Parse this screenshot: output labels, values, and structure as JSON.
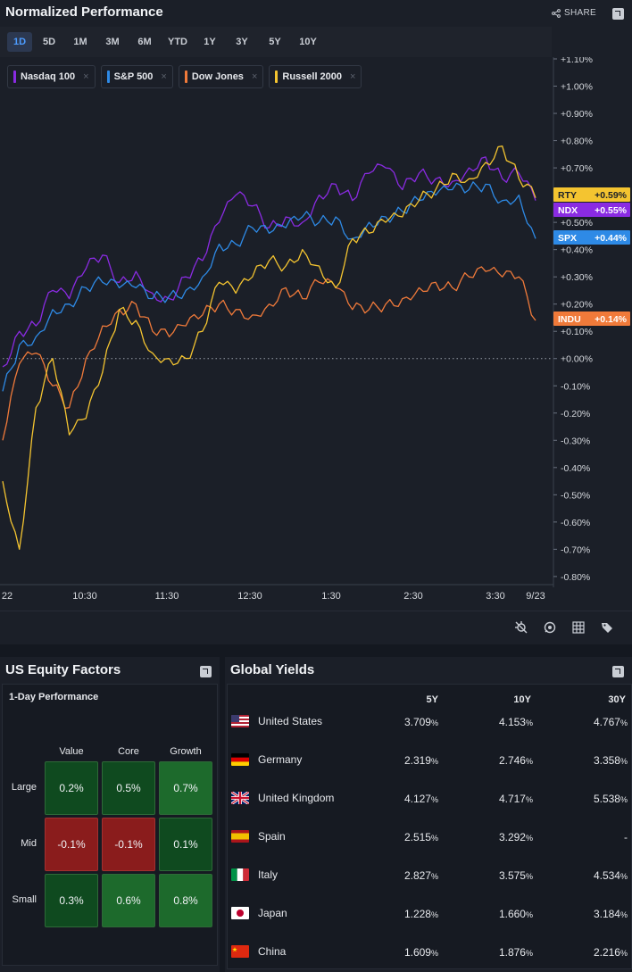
{
  "perf": {
    "title": "Normalized Performance",
    "share_label": "SHARE",
    "ranges": [
      "1D",
      "5D",
      "1M",
      "3M",
      "6M",
      "YTD",
      "1Y",
      "3Y",
      "5Y",
      "10Y"
    ],
    "active_range": "1D"
  },
  "legend": [
    {
      "name": "Nasdaq 100",
      "color": "#8a2be2"
    },
    {
      "name": "S&P 500",
      "color": "#2e8ae6"
    },
    {
      "name": "Dow Jones",
      "color": "#f07a3a"
    },
    {
      "name": "Russell 2000",
      "color": "#f4c430"
    }
  ],
  "chart_data": {
    "type": "line",
    "y_ticks": [
      "+1.10%",
      "+1.00%",
      "+0.90%",
      "+0.80%",
      "+0.70%",
      "+0.60%",
      "+0.50%",
      "+0.40%",
      "+0.30%",
      "+0.20%",
      "+0.10%",
      "+0.00%",
      "-0.10%",
      "-0.20%",
      "-0.30%",
      "-0.40%",
      "-0.50%",
      "-0.60%",
      "-0.70%",
      "-0.80%"
    ],
    "x_ticks": [
      "22",
      "10:30",
      "11:30",
      "12:30",
      "1:30",
      "2:30",
      "3:30",
      "9/23"
    ],
    "ylim": [
      -0.82,
      1.1
    ],
    "baseline": 0,
    "series": [
      {
        "name": "Nasdaq 100",
        "color": "#8a2be2",
        "tag": "NDX",
        "tag_label": "+0.55%",
        "values": [
          -0.03,
          0.1,
          0.12,
          0.25,
          0.22,
          0.33,
          0.38,
          0.28,
          0.32,
          0.24,
          0.22,
          0.3,
          0.36,
          0.5,
          0.6,
          0.56,
          0.48,
          0.52,
          0.5,
          0.6,
          0.64,
          0.58,
          0.68,
          0.7,
          0.62,
          0.68,
          0.66,
          0.65,
          0.7,
          0.74,
          0.66,
          0.68,
          0.58
        ]
      },
      {
        "name": "S&P 500",
        "color": "#2e8ae6",
        "tag": "SPX",
        "tag_label": "+0.44%",
        "values": [
          -0.12,
          0.05,
          0.08,
          0.18,
          0.2,
          0.26,
          0.28,
          0.26,
          0.26,
          0.22,
          0.23,
          0.25,
          0.3,
          0.42,
          0.42,
          0.48,
          0.46,
          0.48,
          0.52,
          0.5,
          0.52,
          0.44,
          0.5,
          0.52,
          0.54,
          0.58,
          0.6,
          0.62,
          0.62,
          0.64,
          0.58,
          0.6,
          0.44
        ]
      },
      {
        "name": "Dow Jones",
        "color": "#f07a3a",
        "tag": "INDU",
        "tag_label": "+0.14%",
        "values": [
          -0.3,
          -0.02,
          0.02,
          -0.1,
          -0.18,
          0.0,
          0.12,
          0.18,
          0.2,
          0.1,
          0.08,
          0.12,
          0.16,
          0.2,
          0.18,
          0.16,
          0.2,
          0.26,
          0.22,
          0.28,
          0.26,
          0.18,
          0.18,
          0.2,
          0.22,
          0.26,
          0.28,
          0.26,
          0.3,
          0.32,
          0.3,
          0.3,
          0.14
        ]
      },
      {
        "name": "Russell 2000",
        "color": "#f4c430",
        "tag": "RTY",
        "tag_label": "+0.59%",
        "values": [
          -0.45,
          -0.7,
          -0.18,
          0.0,
          -0.28,
          -0.22,
          -0.05,
          0.18,
          0.14,
          0.02,
          0.0,
          0.0,
          0.1,
          0.28,
          0.24,
          0.3,
          0.36,
          0.34,
          0.4,
          0.34,
          0.26,
          0.44,
          0.46,
          0.5,
          0.52,
          0.58,
          0.62,
          0.68,
          0.66,
          0.72,
          0.78,
          0.66,
          0.59
        ]
      }
    ]
  },
  "factors": {
    "title": "US Equity Factors",
    "subtitle": "1-Day Performance",
    "columns": [
      "Value",
      "Core",
      "Growth"
    ],
    "rows": [
      "Large",
      "Mid",
      "Small"
    ],
    "cells": [
      [
        {
          "label": "0.2%",
          "color": "#0f4a1f"
        },
        {
          "label": "0.5%",
          "color": "#0f4a1f"
        },
        {
          "label": "0.7%",
          "color": "#1d6a2c"
        }
      ],
      [
        {
          "label": "-0.1%",
          "color": "#8a1c1c"
        },
        {
          "label": "-0.1%",
          "color": "#8a1c1c"
        },
        {
          "label": "0.1%",
          "color": "#0f4a1f"
        }
      ],
      [
        {
          "label": "0.3%",
          "color": "#0f4a1f"
        },
        {
          "label": "0.6%",
          "color": "#1d6a2c"
        },
        {
          "label": "0.8%",
          "color": "#1d6a2c"
        }
      ]
    ]
  },
  "yields": {
    "title": "Global Yields",
    "headers": [
      "5Y",
      "10Y",
      "30Y"
    ],
    "rows": [
      {
        "country": "United States",
        "flag": "us-flag-icon",
        "y5": "3.709",
        "y10": "4.153",
        "y30": "4.767"
      },
      {
        "country": "Germany",
        "flag": "de-flag-icon",
        "y5": "2.319",
        "y10": "2.746",
        "y30": "3.358"
      },
      {
        "country": "United Kingdom",
        "flag": "uk-flag-icon",
        "y5": "4.127",
        "y10": "4.717",
        "y30": "5.538"
      },
      {
        "country": "Spain",
        "flag": "es-flag-icon",
        "y5": "2.515",
        "y10": "3.292",
        "y30": "-"
      },
      {
        "country": "Italy",
        "flag": "it-flag-icon",
        "y5": "2.827",
        "y10": "3.575",
        "y30": "4.534"
      },
      {
        "country": "Japan",
        "flag": "jp-flag-icon",
        "y5": "1.228",
        "y10": "1.660",
        "y30": "3.184"
      },
      {
        "country": "China",
        "flag": "cn-flag-icon",
        "y5": "1.609",
        "y10": "1.876",
        "y30": "2.216"
      }
    ],
    "unit": "%"
  }
}
